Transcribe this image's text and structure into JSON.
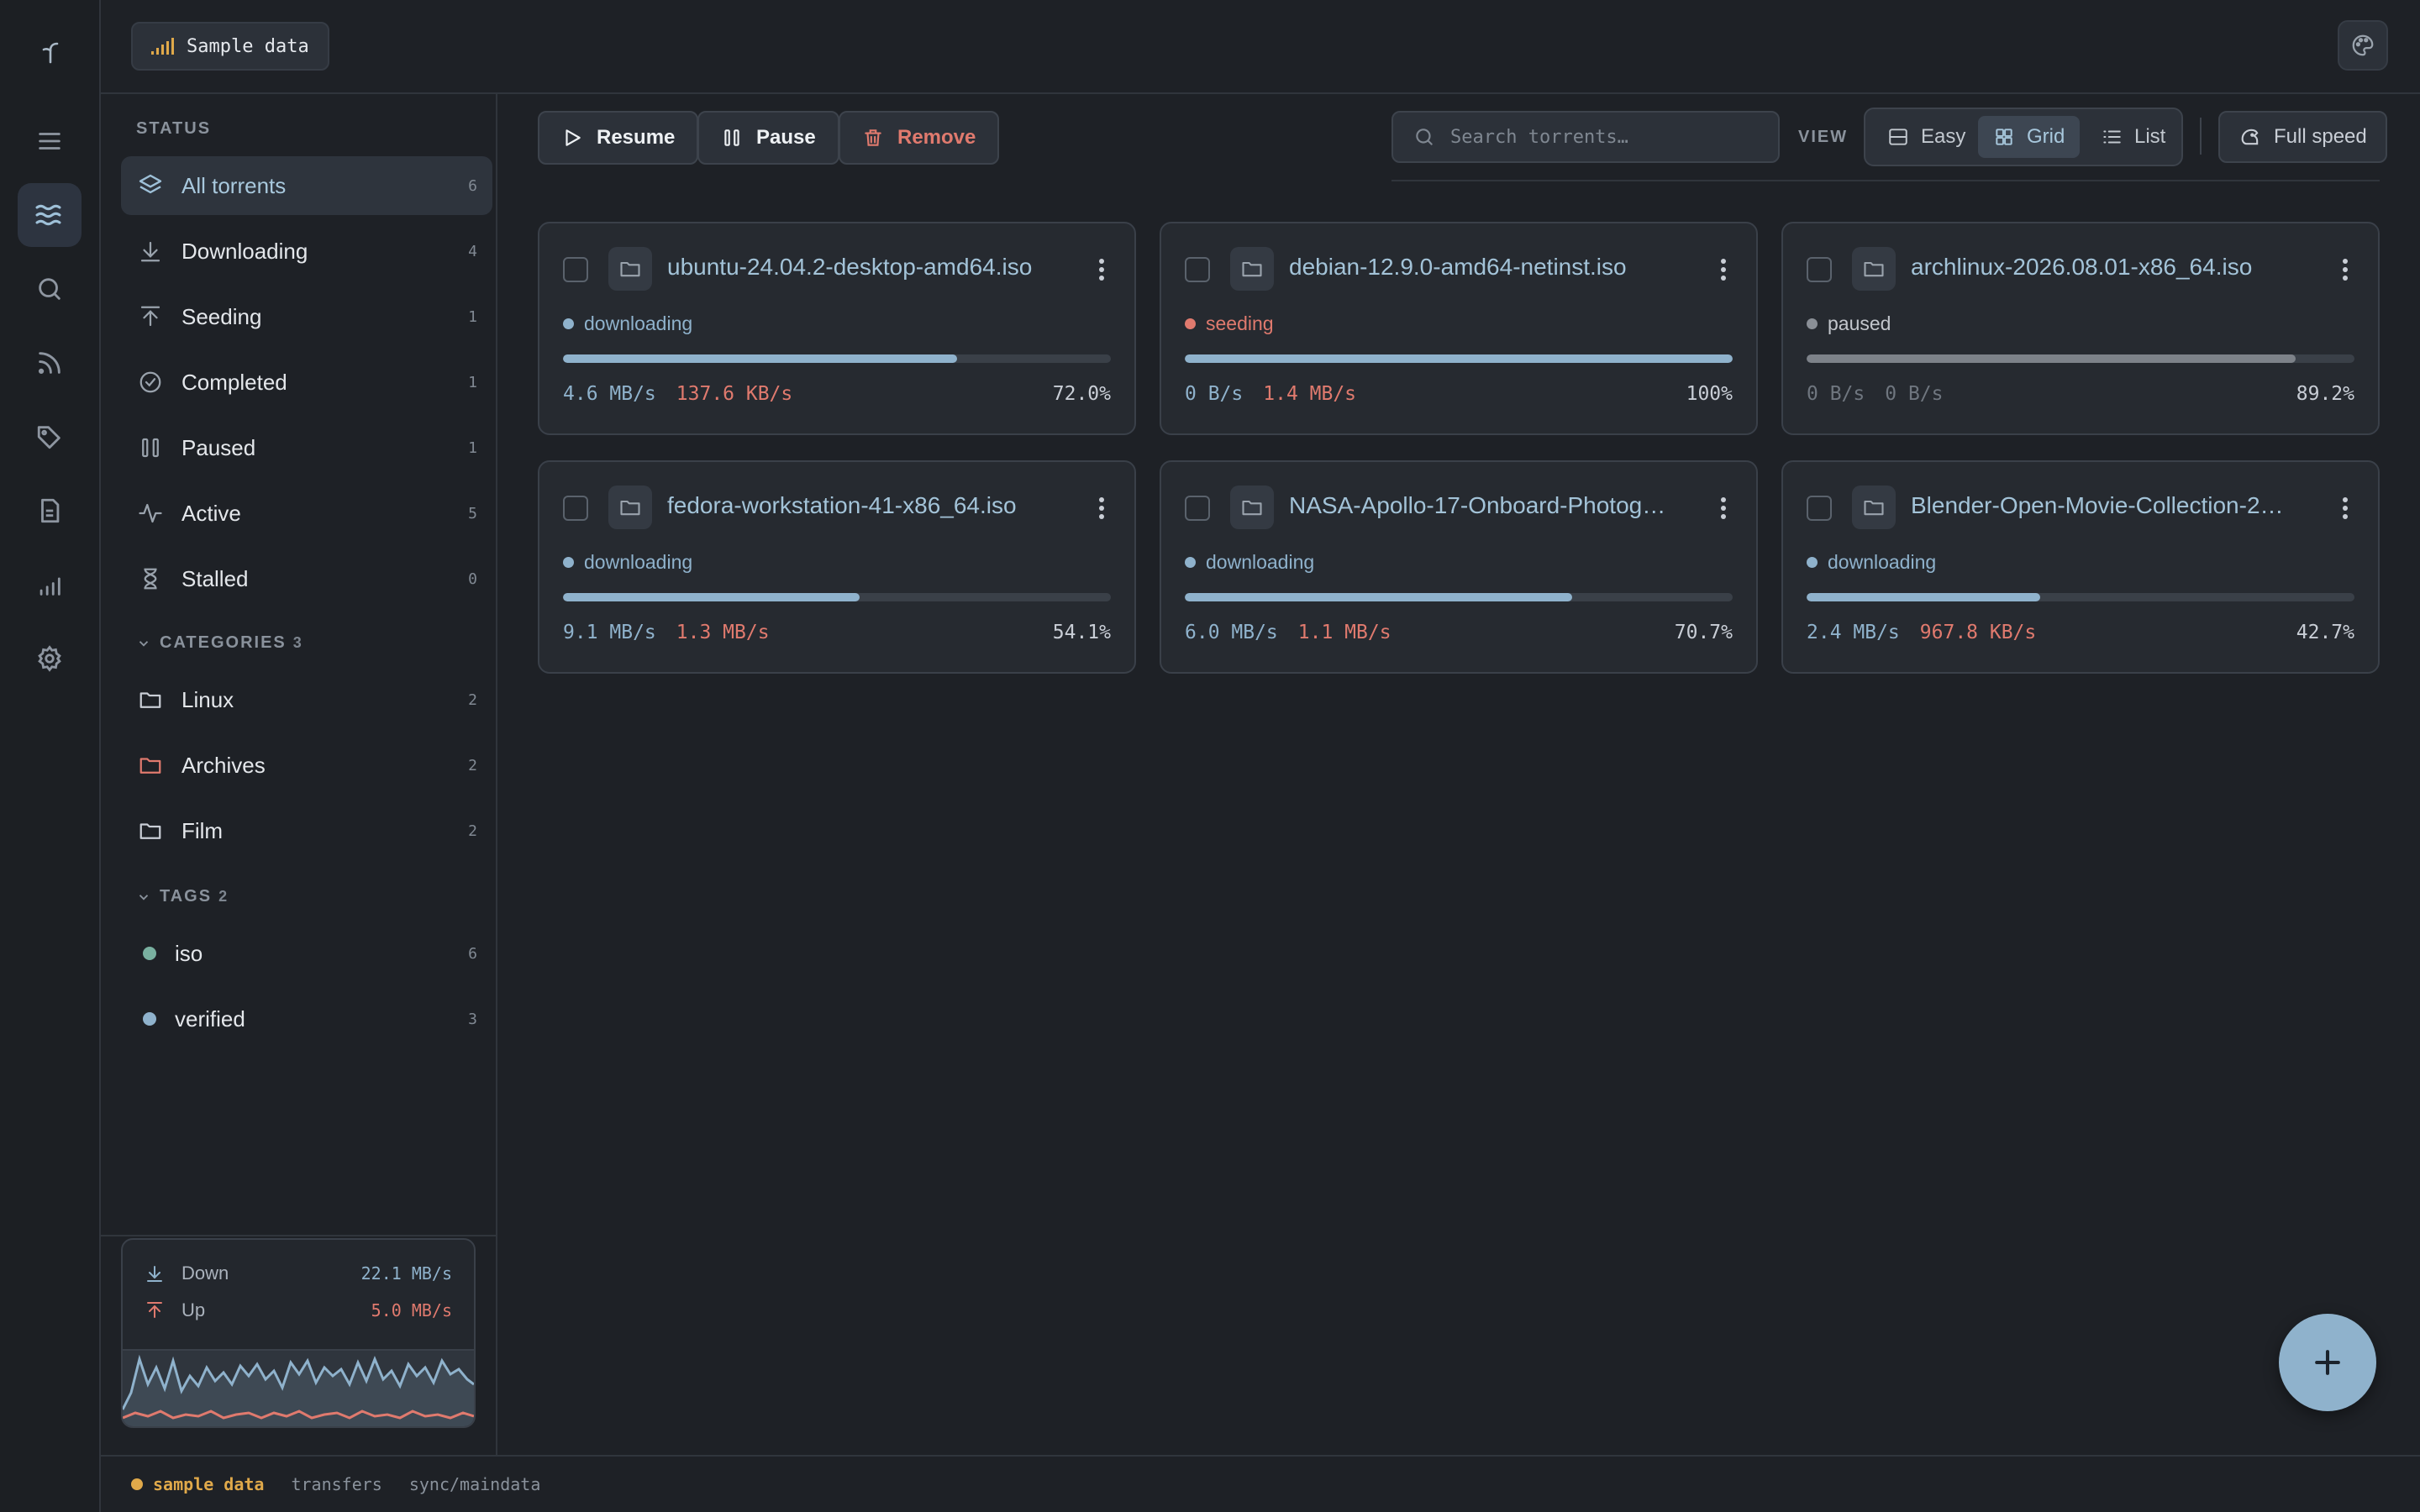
{
  "topbar": {
    "sample_label": "Sample data"
  },
  "sidebar": {
    "status_heading": "STATUS",
    "status_items": [
      {
        "label": "All torrents",
        "count": "6"
      },
      {
        "label": "Downloading",
        "count": "4"
      },
      {
        "label": "Seeding",
        "count": "1"
      },
      {
        "label": "Completed",
        "count": "1"
      },
      {
        "label": "Paused",
        "count": "1"
      },
      {
        "label": "Active",
        "count": "5"
      },
      {
        "label": "Stalled",
        "count": "0"
      }
    ],
    "categories_heading": "CATEGORIES",
    "categories_count": "3",
    "categories": [
      {
        "label": "Linux",
        "count": "2",
        "color": "#c9ced6"
      },
      {
        "label": "Archives",
        "count": "2",
        "color": "#e07a6e"
      },
      {
        "label": "Film",
        "count": "2",
        "color": "#c9ced6"
      }
    ],
    "tags_heading": "TAGS",
    "tags_count": "2",
    "tags": [
      {
        "label": "iso",
        "count": "6",
        "color": "#79b0a0"
      },
      {
        "label": "verified",
        "count": "3",
        "color": "#8fb2cc"
      }
    ],
    "speed": {
      "down_label": "Down",
      "down_value": "22.1 MB/s",
      "up_label": "Up",
      "up_value": "5.0 MB/s"
    }
  },
  "toolbar": {
    "resume": "Resume",
    "pause": "Pause",
    "remove": "Remove",
    "search_placeholder": "Search torrents…",
    "view_label": "VIEW",
    "views": [
      "Easy",
      "Grid",
      "List"
    ],
    "active_view": "Grid",
    "full_speed": "Full speed"
  },
  "torrents": [
    {
      "name": "ubuntu-24.04.2-desktop-amd64.iso",
      "state": "downloading",
      "progress": 0.72,
      "down": "4.6 MB/s",
      "up": "137.6 KB/s",
      "pct": "72.0%"
    },
    {
      "name": "debian-12.9.0-amd64-netinst.iso",
      "state": "seeding",
      "progress": 1.0,
      "down": "0 B/s",
      "up": "1.4 MB/s",
      "pct": "100%"
    },
    {
      "name": "archlinux-2026.08.01-x86_64.iso",
      "state": "paused",
      "progress": 0.892,
      "down": "0 B/s",
      "up": "0 B/s",
      "pct": "89.2%"
    },
    {
      "name": "fedora-workstation-41-x86_64.iso",
      "state": "downloading",
      "progress": 0.541,
      "down": "9.1 MB/s",
      "up": "1.3 MB/s",
      "pct": "54.1%"
    },
    {
      "name": "NASA-Apollo-17-Onboard-Photog…",
      "state": "downloading",
      "progress": 0.707,
      "down": "6.0 MB/s",
      "up": "1.1 MB/s",
      "pct": "70.7%"
    },
    {
      "name": "Blender-Open-Movie-Collection-2…",
      "state": "downloading",
      "progress": 0.427,
      "down": "2.4 MB/s",
      "up": "967.8 KB/s",
      "pct": "42.7%"
    }
  ],
  "state_colors": {
    "downloading": "#8fb2cc",
    "seeding": "#e07a6e",
    "paused": "#8a8f96"
  },
  "statusbar": {
    "live": "sample data",
    "item1": "transfers",
    "item2": "sync/maindata"
  }
}
